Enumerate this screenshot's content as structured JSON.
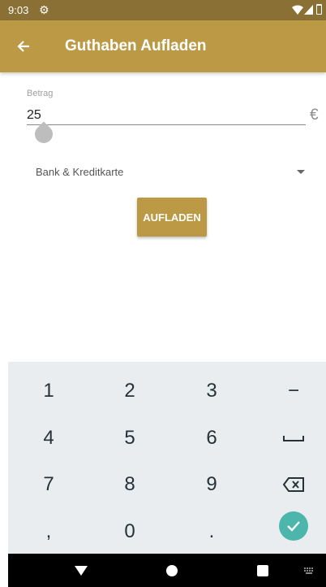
{
  "status_bar": {
    "time": "9:03",
    "icons": [
      "gear-icon",
      "wifi-icon",
      "signal-icon",
      "battery-icon"
    ]
  },
  "app_bar": {
    "title": "Guthaben Aufladen",
    "back_icon": "arrow-left-icon"
  },
  "form": {
    "amount_label": "Betrag",
    "amount_value": "25",
    "currency": "€",
    "payment_method": "Bank & Kreditkarte",
    "submit_label": "AUFLADEN"
  },
  "keyboard": {
    "keys": [
      "1",
      "2",
      "3",
      "−",
      "4",
      "5",
      "6",
      "␣",
      "7",
      "8",
      "9",
      "⌫",
      ",",
      "0",
      ".",
      "✓"
    ]
  },
  "colors": {
    "accent": "#bb9945",
    "status_bar": "#8a7035",
    "check": "#4db6ac"
  }
}
